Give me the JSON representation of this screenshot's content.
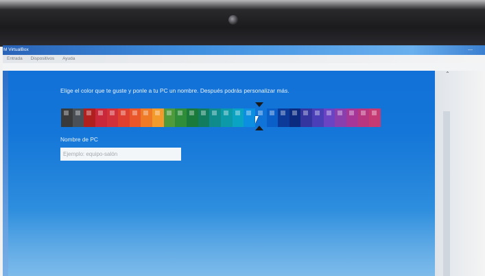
{
  "window": {
    "title": "M VirtualBox"
  },
  "menu": {
    "items": [
      "Entrada",
      "Dispositivos",
      "Ayuda"
    ]
  },
  "setup": {
    "instruction": "Elige el color que te guste y ponle a tu PC un nombre. Después podrás personalizar más.",
    "selected_color_index": 17,
    "palette": [
      "#3a3a3a",
      "#4b4f56",
      "#b0201e",
      "#c8283a",
      "#d2313a",
      "#de3f2e",
      "#e8562a",
      "#ee7a26",
      "#f39a2c",
      "#4f9a3a",
      "#2f8c39",
      "#1a7a3a",
      "#127d5e",
      "#0f8b8c",
      "#0c9aa8",
      "#0aa3c4",
      "#0c8fe0",
      "#0f73d8",
      "#0b5fc8",
      "#0b3a99",
      "#0a2b80",
      "#3535a0",
      "#4b3fb8",
      "#6a44c2",
      "#8a3fae",
      "#a63698",
      "#b8357f",
      "#c63a74"
    ],
    "pc_name_label": "Nombre de PC",
    "pc_name_value": "",
    "pc_name_placeholder": "Ejemplo: equipo-salón"
  }
}
